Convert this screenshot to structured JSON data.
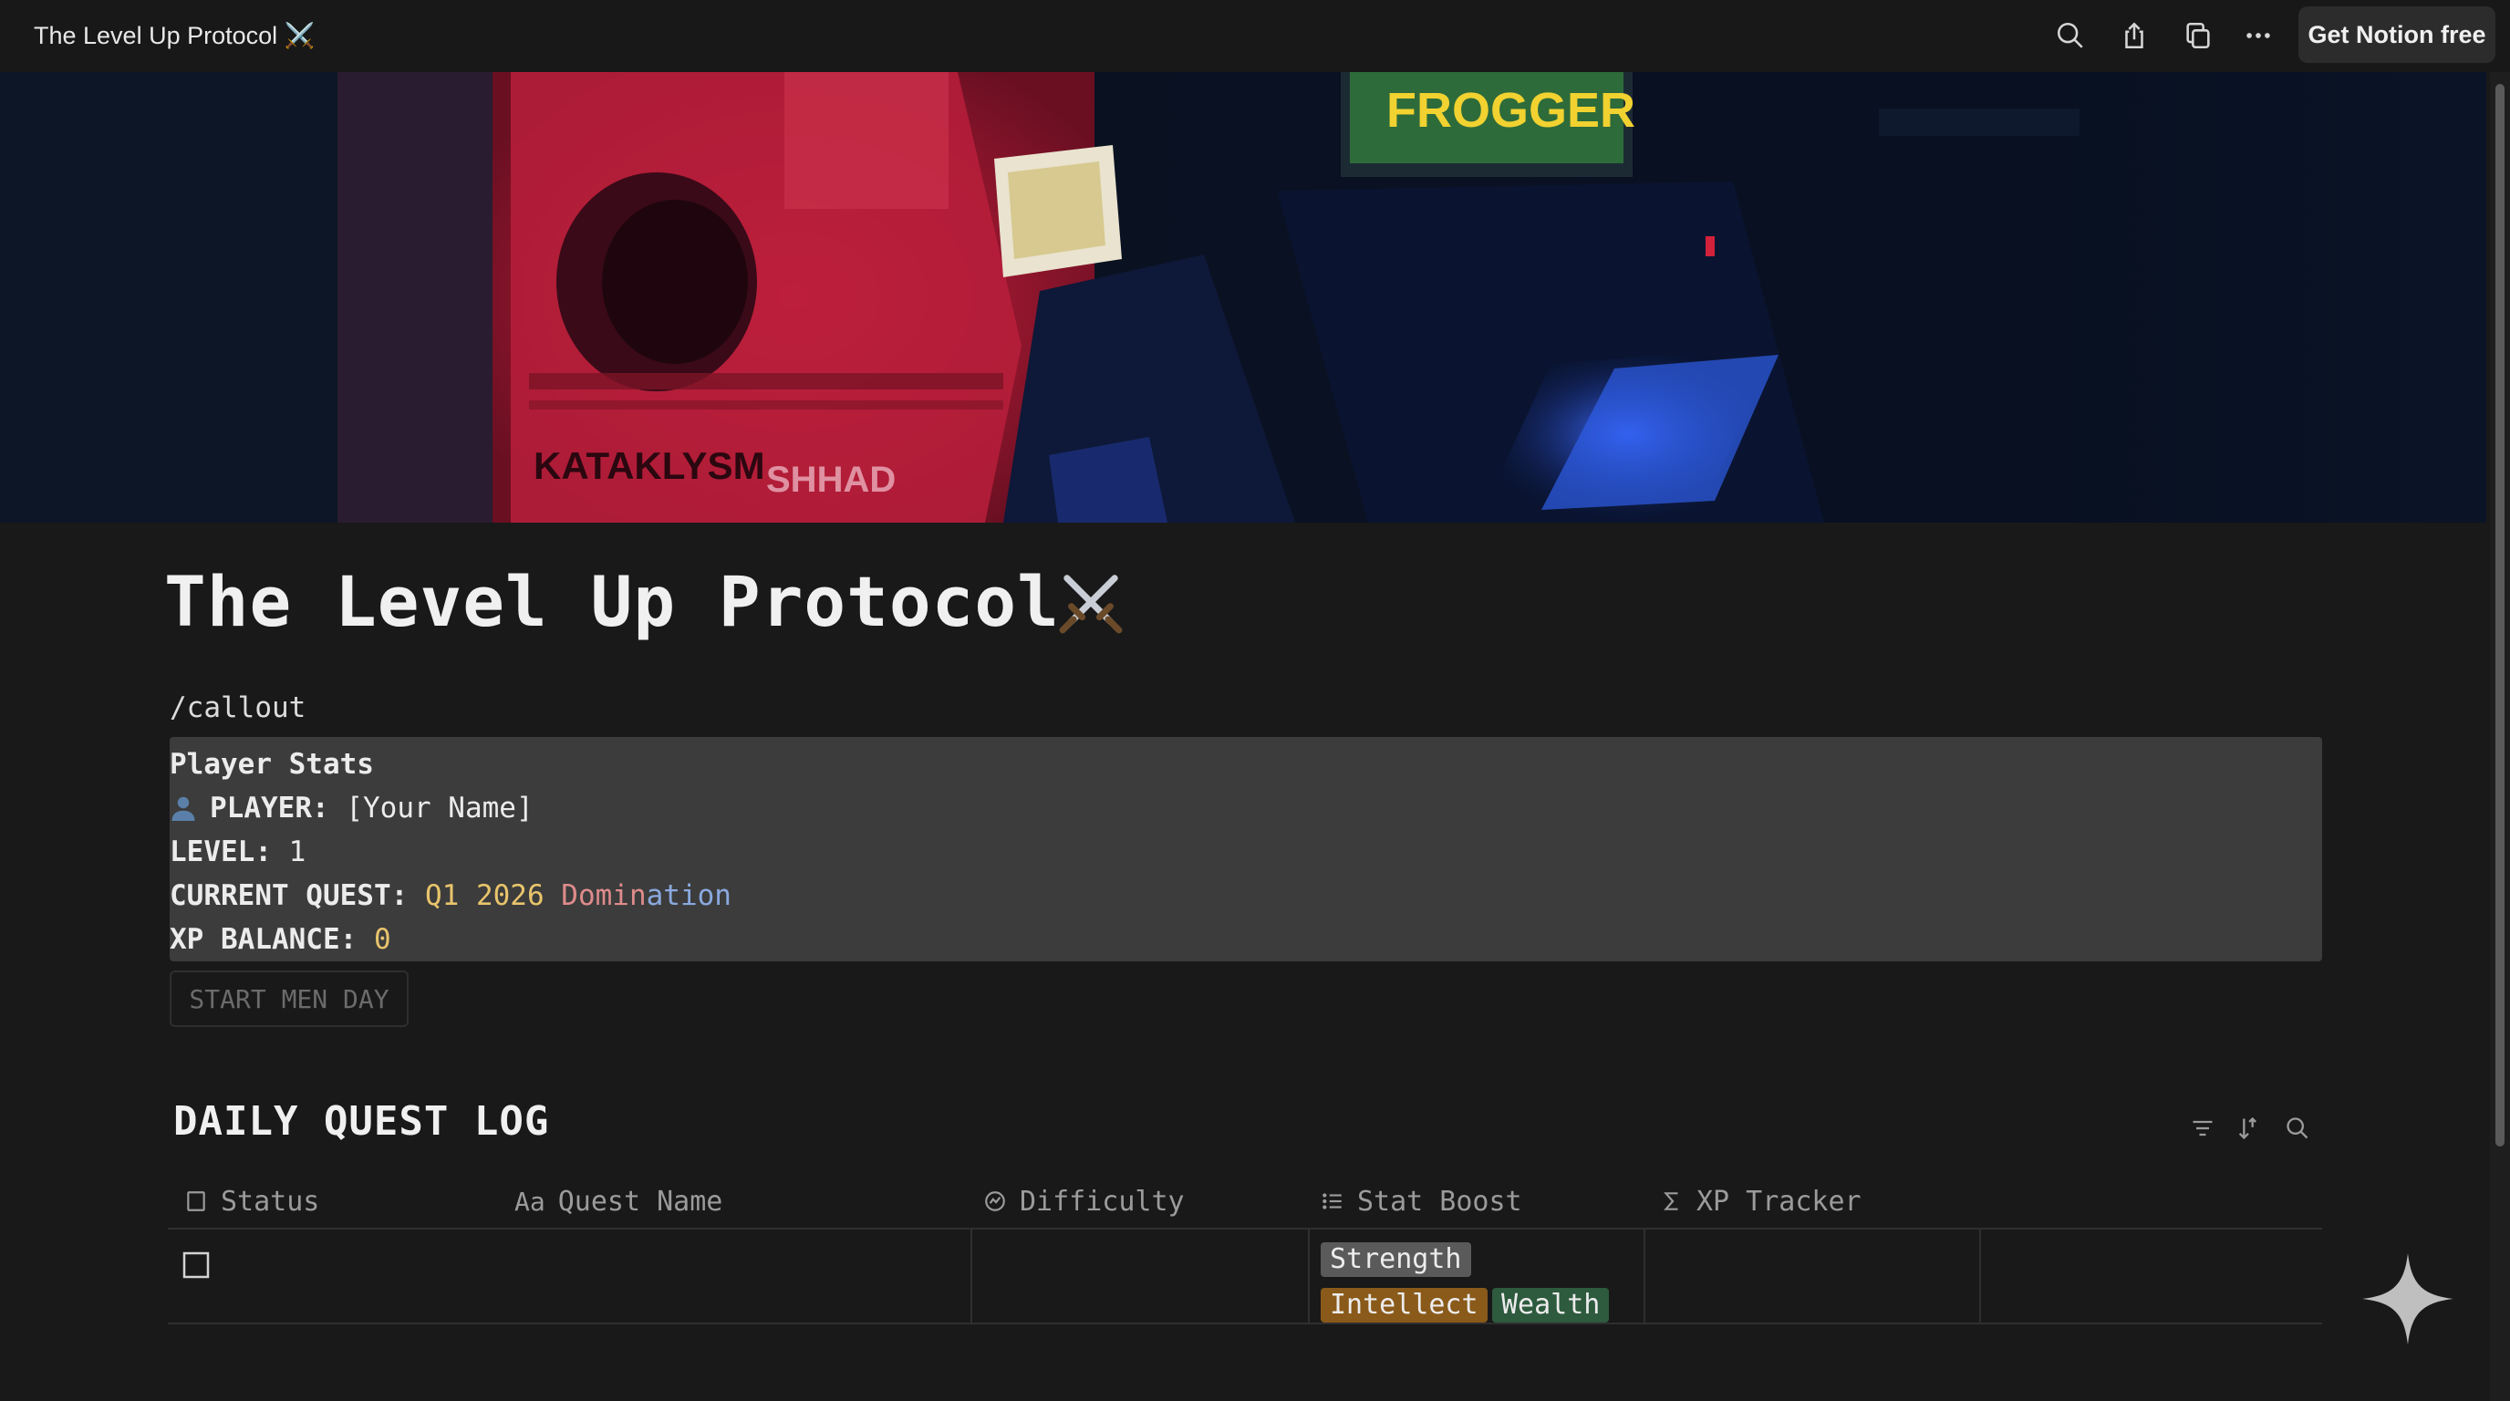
{
  "topbar": {
    "page_name": "The Level Up Protocol ⚔️",
    "get_notion_label": "Get Notion free",
    "icons": [
      "search-icon",
      "share-icon",
      "duplicate-icon",
      "more-icon"
    ]
  },
  "cover": {
    "sign_texts": [
      "FROGGER",
      "KATAKLYSM",
      "SHHAD"
    ]
  },
  "page": {
    "title": "The Level Up Protocol",
    "title_emoji": "swords-icon",
    "slash_command": "/callout"
  },
  "callout": {
    "heading": "Player Stats",
    "player_label": "PLAYER:",
    "player_value": "[Your Name]",
    "level_label": "LEVEL:",
    "level_value": "1",
    "quest_label": "CURRENT QUEST:",
    "quest_q": "Q1",
    "quest_year": "2026",
    "quest_word_a": "Domin",
    "quest_word_b": "ation",
    "xp_label": "XP BALANCE:",
    "xp_value": "0"
  },
  "start_button": "START MEN DAY",
  "database": {
    "title": "DAILY QUEST LOG",
    "columns": [
      {
        "icon": "checkbox-icon",
        "label": "Status"
      },
      {
        "icon": "text-icon",
        "prefix": "Aa",
        "label": "Quest Name"
      },
      {
        "icon": "status-icon",
        "label": "Difficulty"
      },
      {
        "icon": "list-icon",
        "label": "Stat Boost"
      },
      {
        "icon": "sigma-icon",
        "label": "XP Tracker"
      }
    ],
    "rows": [
      {
        "status": false,
        "quest_name": "",
        "difficulty": "",
        "stat_boost": [
          "Strength",
          "Intellect",
          "Wealth"
        ],
        "xp_tracker": ""
      }
    ]
  },
  "colors": {
    "background": "#191919",
    "callout_bg": "#3c3c3c",
    "tag_strength": "#5a5a5a",
    "tag_intellect": "#8a5a1a",
    "tag_wealth": "#2e5a3e",
    "accent_yellow": "#e8c46c"
  }
}
